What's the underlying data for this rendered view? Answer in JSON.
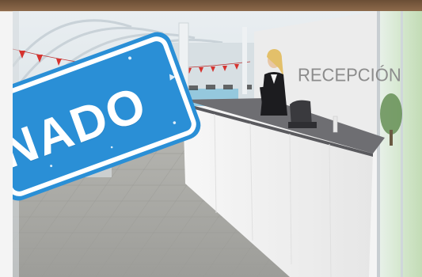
{
  "image": {
    "signage_text": "RECEPCIÓN",
    "stamp_text": "NADO",
    "colors": {
      "stamp_blue": "#2a8fd6",
      "stamp_border": "#1d74b8",
      "wall_white": "#f2f2f2",
      "counter_top": "#6e6e72",
      "floor_tile": "#a7a7a4",
      "pennant_red": "#d6332f",
      "glass_green": "#cfe2c4",
      "frame_brown": "#6b4e35"
    },
    "icons": [
      "receptionist-figure",
      "office-chair",
      "pennant-garland",
      "potted-plant"
    ]
  }
}
